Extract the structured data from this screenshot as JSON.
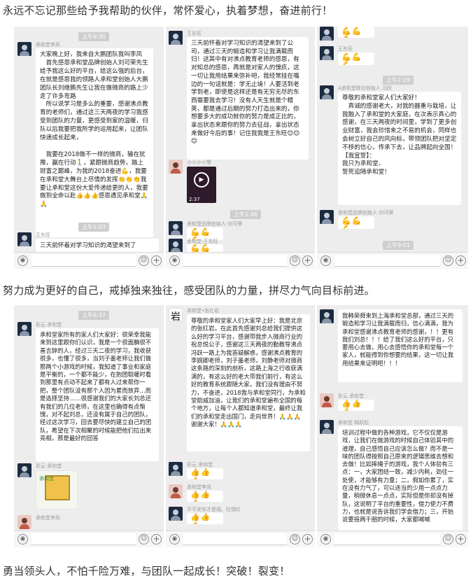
{
  "captions": {
    "one": "永远不忘记那些给予我帮助的伙伴，常怀爱心，执着梦想，奋进前行！",
    "two": "努力成为更好的自己，戒掉独来独往，感受团队的力量，拼尽力气向目标前进。",
    "three": "勇当领头人，不怕千险万难，与团队一起成长！突破！裂变！"
  },
  "chats": {
    "s1": {
      "ts1": "上午9:30",
      "sender1": "承和堂李凤",
      "m1": "大家晚上好，我来自大鹏团队我叫李凤\n　首先感恩承和堂品牌创始人刘可荣先生给予我这么好的平台，给这么强的后台，在就是感恩我的领路人承和堂创始人大鹏团队长刘继鹏先生让我在做微商的路上少走了许多弯路\n　所以说学习是多么的重要，感谢沸点教育的老师们，通过这三天两夜的学习我感受到团队的力量，更感受到家的温暖，归队以后我要把我所学的运用起来，让团队快速成长起来，\n\n　我要在2018做不一样的微商，输在犹豫，赢在行动🚶，紧跟微商趋势，踏上财富之巅峰，为我的2018奋进💪，我要在承和堂大舞台上尽情的发挥👏👏👏我要让承和堂这份大爱传递给更的人，我要做到全命以赴👍👍👍感恩遇见承和堂🙏🙏",
      "ts2": "上午1:03",
      "sender2": "王东旺",
      "m2": "三天前怀着对学习知识的渴望来到了"
    },
    "s2": {
      "sender1": "王东旺",
      "m1": "三天前怀着对学习知识的渴望来到了公司，通过三天的锻造和学习让我满载而归！这其中有对沸点教育老师的感恩，有对知总的感恩，再就是对家人的愧疚，这一切让我用结果来弥补吧，我经常挂在嘴边的一句话就是：学无止境！人要活到老学到老，即使是这样还是有无穷无尽的东西需要我去学习！没有人天生就是个精英，都是通过后期的努力打造出来的，你想要多大的成功就你的努力是成正比的，拿出状态来跟你的努力去征战，拿出状态来做好今后的事！记住我我是王东旺😊😊😊",
      "sender2": "小小小小慧",
      "vid_dur": "2:37",
      "ts": "上午1:46",
      "sender3": "承和堂品牌创始人-刘可荣",
      "emoji1": "💪💪💪",
      "sender4": "承和堂-王东旺",
      "emoji2": "💪💪💪",
      "ts2": "上午9:01"
    },
    "s3": {
      "emoji1": "💪💪💪",
      "sender1": "王东旺",
      "emoji2": "💪💪💪",
      "ts": "上午2:29",
      "sender2": "A承和堂联合创始人 冯跃",
      "m2": "尊敬的承和堂家人们大家好！\n　真诚的感谢老大，对我的器重与栽培，让我融入了承和堂的大家庭，在次表示真心的感谢，在三天两夜的时间里，学到了更多创业财富，我会珍惜来之不易的机会，同样也会树立好自己的风向标，带领团队把对坚定不移的信心，传承下去，让品牌起向全国！\n【我宣誓】：\n我只为承和堂、\n誓死追随承和堂！",
      "sender3": "承和堂品牌创始人-刘可荣",
      "emoji3": "💪💪💪",
      "ts2": "上午9:01"
    },
    "s4": {
      "ts": "上午6:37",
      "sender1": "彩云 承和堂",
      "m1": "承和堂家所有的家人们大家好：很荣幸我能来到这里跟你们认识，我是一个很面腆很不善言辞的人，经过三天二夜的学习，我收获很多，也懂了很多，当刘子墨老师让我们做那两个小游戏的时候，我知道了事业和家庭是平衡的，一个都不能少，在抱团取暖时看到那里有点动不起来了都有人过来帮你一把，整个团队没有那个人因为累而放弃…而是选择坚持……很感谢我们的大家长刘总还有我们的几位老师，在这里也确得有点惭愧，对不起刘总，还没有属于自己的团队，经过这次学习，回去要尽快的建立自己的团队，希望在下次相聚的时候能把他们拉出来亮相，那是最好的回答",
      "sender2": "彩云 承和堂",
      "sender3": "承和堂李凤",
      "poster_cap": "承和堂"
    },
    "s5": {
      "ts": "承和堂•张红岩",
      "m1": "尊敬的承和堂家人们大家早上好：我是北京的张红岩，在此首先感谢刘总给我们提供这么好的学习平台，感谢带我步入微商行业的祝总悦公子，感谢这三天两夜的勤教导沸点冯跃一路上为我答疑解惑，感谢沸点教育的李婉卿老师，刘子墨老师，刘静老师对微商这条路的深刻的剖析，这路上海之行收获满满的，有这么好的老大带我们前行，有这么好的教育系统跟随大家，我们没有理由不努力，不奋进，2018我与承和堂同行，为承和堂助威加油，让我们的承和堂遍布全国的每个地方，让每个人都知道承和堂，最终让我们的承和堂走出国门，走向世界！🙏🙏🙏谢谢大家！🙏🙏🙏",
      "sender2": "彩云 承和堂",
      "emoji2": "👍👍👍",
      "sender3": "承和堂李凤",
      "emoji3": "👍👍👍",
      "sender4": "平平安安才是福。杜瑞红",
      "emoji4": "👍👍👍"
    },
    "s6": {
      "m1": "我韩荣舜来到上海承和堂总部，通过三天的锻造和学习让我满载而归，信心满满，我为承和堂感谢沸点教育老师的感谢，！！更有我们刘总！！！给了我们这么好的平台，只要用心去做，用心去感悟你的承和堂每一个家人，就能得到你想要的结果，这一切让我用结果来证明吧！！！",
      "sender2": "彩云 承和堂",
      "emoji2": "👍👍👍",
      "sender3": "承和堂 韩跃松",
      "m3": "培训过程中做的各种游戏，它不仅仅是游戏，让我们在做游戏的时候自己体验其中的道理，自己感悟自己应该怎么做？而不是一味的团队得按照自己原来的逻辑思维去想和去做！比如摔绳子的游戏，我个人体验有三点：一，大家团结一致，减少内耗，劲往一处使，才能够有力量；二，假如你累了，实在没有力气了，可以适当的少用一点点力量，稍微休息一点点，实际但是你却没有掉队，这说明了平台的重要性，借力使力不费力，也就是说告诉我们学会借力；三，开始说要摇两千圈的时候，大家都喊喊"
    }
  }
}
